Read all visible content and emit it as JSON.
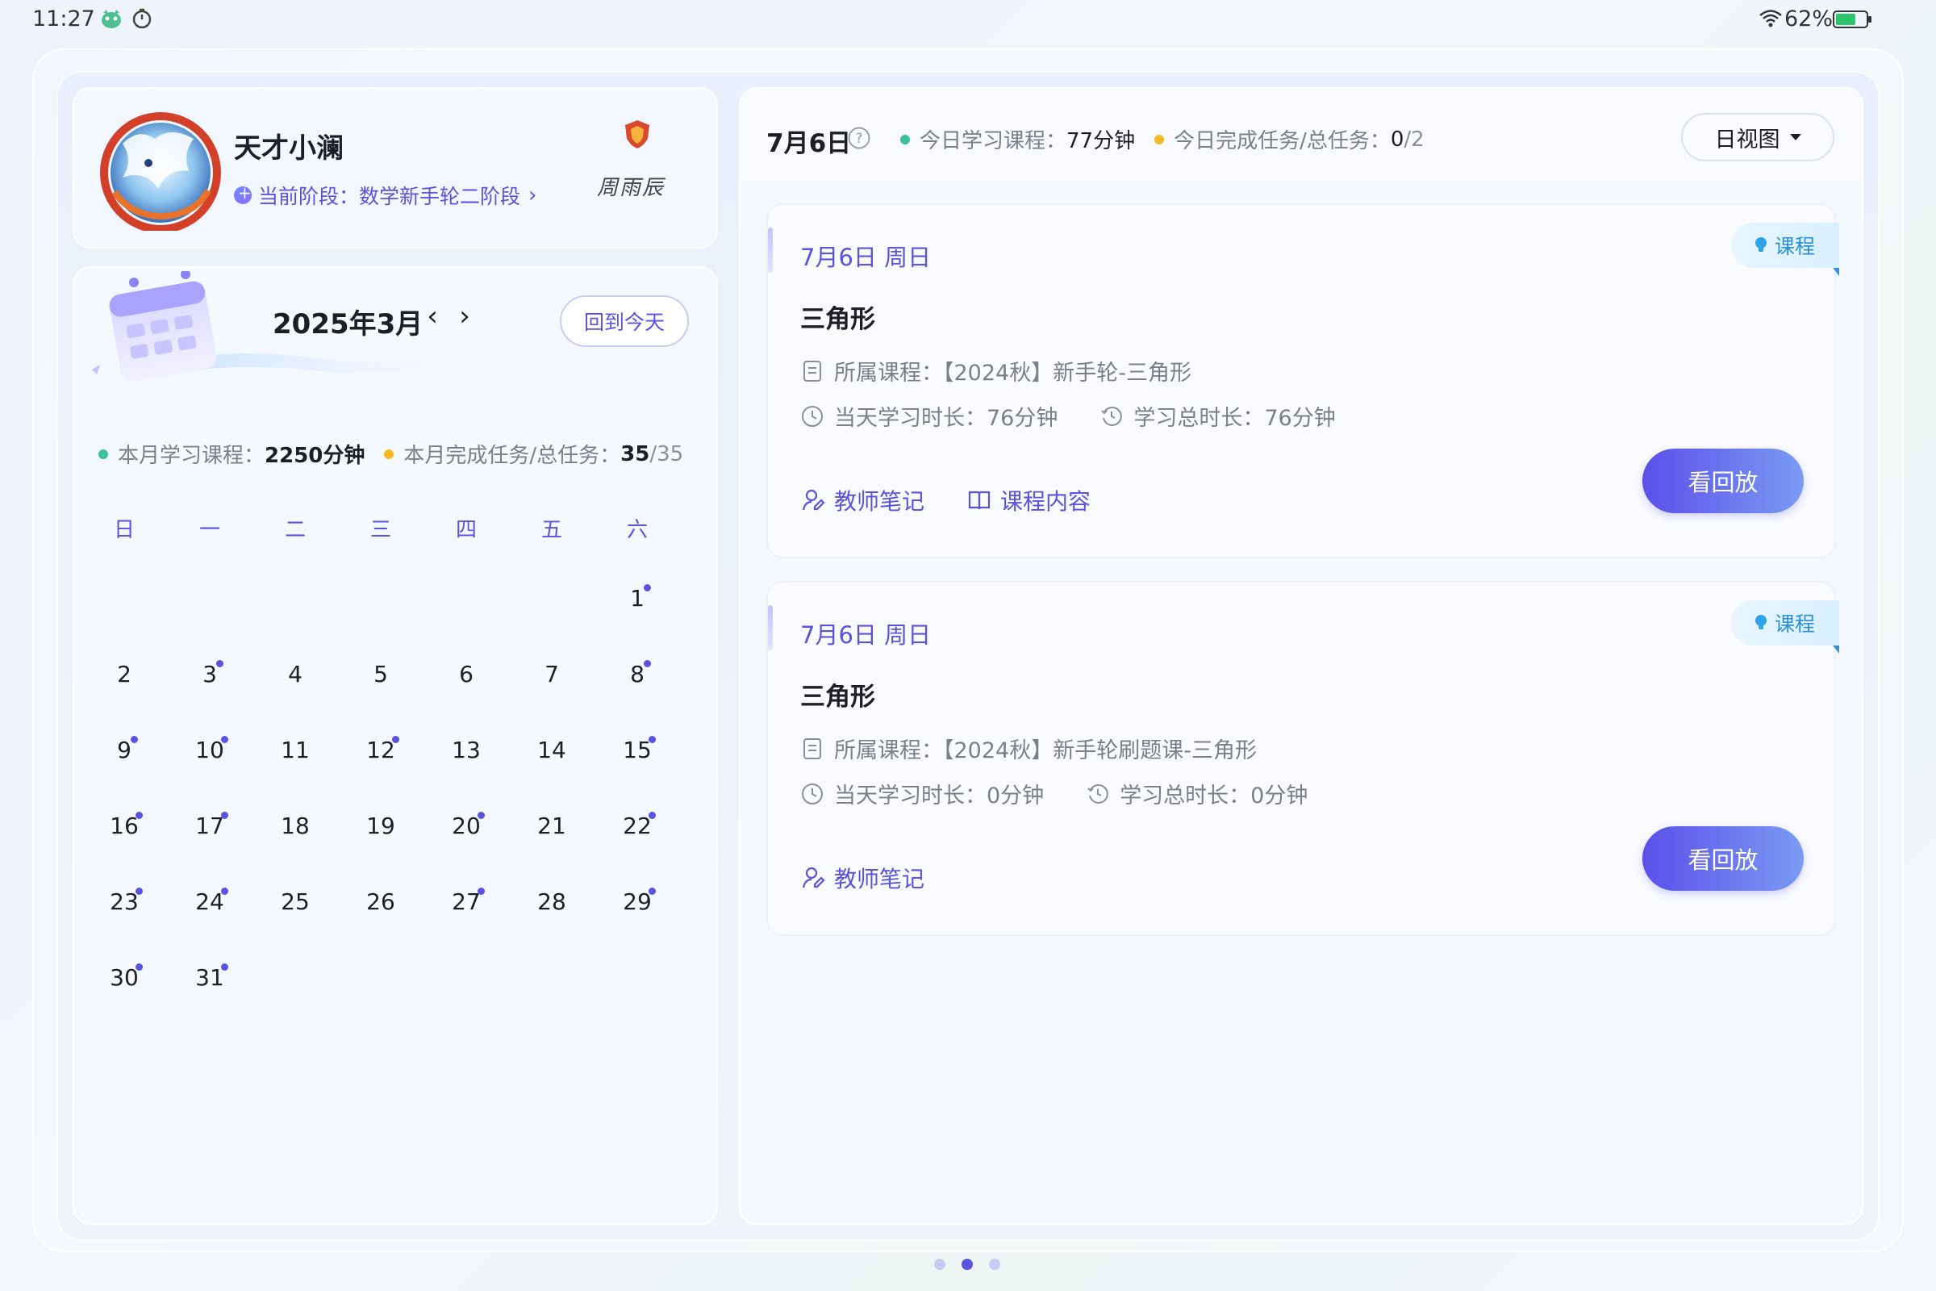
{
  "status_bar": {
    "time": "11:27",
    "battery": "62%"
  },
  "profile": {
    "name": "天才小澜",
    "stage": "当前阶段：数学新手轮二阶段",
    "signature": "周雨辰"
  },
  "calendar": {
    "month_title": "2025年3月",
    "prev_label": "‹",
    "next_label": "›",
    "today_button": "回到今天",
    "stats": {
      "course_label": "本月学习课程：",
      "course_value": "2250分钟",
      "task_label": "本月完成任务/总任务：",
      "task_done": "35",
      "task_total": "/35"
    },
    "weekdays": [
      "日",
      "一",
      "二",
      "三",
      "四",
      "五",
      "六"
    ],
    "first_weekday_index": 6,
    "days": [
      {
        "d": "1",
        "dot": true
      },
      {
        "d": "2",
        "dot": false
      },
      {
        "d": "3",
        "dot": true
      },
      {
        "d": "4",
        "dot": false
      },
      {
        "d": "5",
        "dot": false
      },
      {
        "d": "6",
        "dot": false
      },
      {
        "d": "7",
        "dot": false
      },
      {
        "d": "8",
        "dot": true
      },
      {
        "d": "9",
        "dot": true
      },
      {
        "d": "10",
        "dot": true
      },
      {
        "d": "11",
        "dot": false
      },
      {
        "d": "12",
        "dot": true
      },
      {
        "d": "13",
        "dot": false
      },
      {
        "d": "14",
        "dot": false
      },
      {
        "d": "15",
        "dot": true
      },
      {
        "d": "16",
        "dot": true
      },
      {
        "d": "17",
        "dot": true
      },
      {
        "d": "18",
        "dot": false
      },
      {
        "d": "19",
        "dot": false
      },
      {
        "d": "20",
        "dot": true
      },
      {
        "d": "21",
        "dot": false
      },
      {
        "d": "22",
        "dot": true
      },
      {
        "d": "23",
        "dot": true
      },
      {
        "d": "24",
        "dot": true
      },
      {
        "d": "25",
        "dot": false
      },
      {
        "d": "26",
        "dot": false
      },
      {
        "d": "27",
        "dot": true
      },
      {
        "d": "28",
        "dot": false
      },
      {
        "d": "29",
        "dot": true
      },
      {
        "d": "30",
        "dot": true
      },
      {
        "d": "31",
        "dot": true
      }
    ]
  },
  "today_header": {
    "date": "7月6日",
    "course_label": "今日学习课程：",
    "course_value": "77分钟",
    "task_label": "今日完成任务/总任务：",
    "task_done": "0",
    "task_total": "/2",
    "view_select": "日视图"
  },
  "lessons": [
    {
      "date": "7月6日 周日",
      "tag": "课程",
      "title": "三角形",
      "course": "所属课程：【2024秋】新手轮-三角形",
      "day_time": "当天学习时长：76分钟",
      "total_time": "学习总时长：76分钟",
      "note_label": "教师笔记",
      "content_label": "课程内容",
      "replay_label": "看回放"
    },
    {
      "date": "7月6日 周日",
      "tag": "课程",
      "title": "三角形",
      "course": "所属课程：【2024秋】新手轮刷题课-三角形",
      "day_time": "当天学习时长：0分钟",
      "total_time": "学习总时长：0分钟",
      "note_label": "教师笔记",
      "replay_label": "看回放"
    }
  ],
  "pagination": {
    "count": 3,
    "active_index": 1
  },
  "colors": {
    "accent": "#5b52e0",
    "tag_text": "#2a8fd6",
    "green_dot": "#3cc29a",
    "yellow_dot": "#f5b922"
  }
}
